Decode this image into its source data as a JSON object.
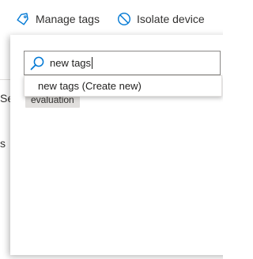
{
  "toolbar": {
    "manage_tags_label": "Manage tags",
    "manage_tags_icon": "tag-icon",
    "isolate_device_label": "Isolate device",
    "isolate_device_icon": "block-icon"
  },
  "background": {
    "fragment_1": "Se",
    "fragment_2": "s"
  },
  "tags_panel": {
    "search": {
      "value": "new tags",
      "icon": "search-icon"
    },
    "suggestions": [
      {
        "label": "new tags (Create new)"
      }
    ],
    "existing_tags": [
      {
        "label": "evaluation"
      }
    ]
  },
  "colors": {
    "accent": "#0078d4",
    "text": "#323130",
    "chip_background": "#e1dfdd",
    "input_border": "#8a8886"
  }
}
